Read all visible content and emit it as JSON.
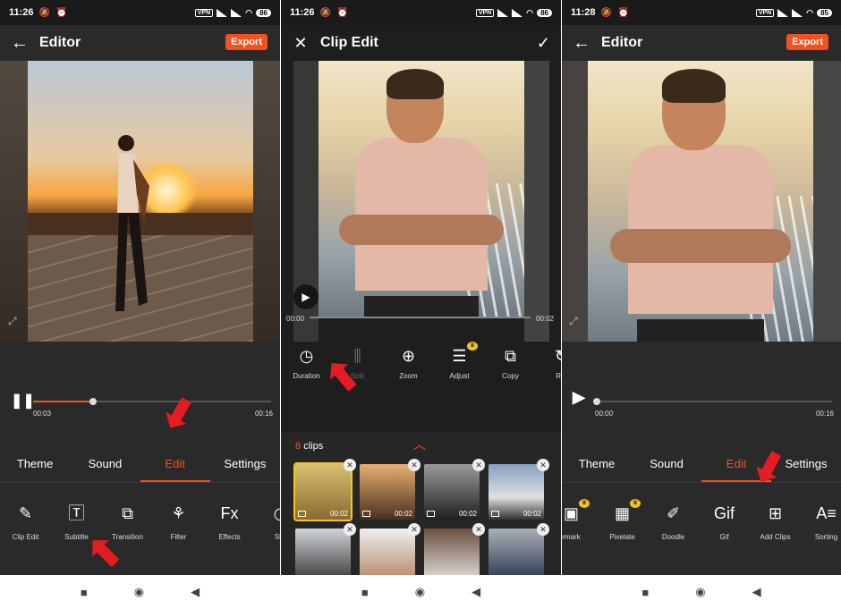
{
  "colors": {
    "accent": "#f4511e",
    "arrow": "#e51c23",
    "crown": "#f5c518"
  },
  "screen1": {
    "status": {
      "time": "11:26",
      "battery": "86",
      "vpn": "VPN"
    },
    "title": "Editor",
    "export_label": "Export",
    "time_current": "00:03",
    "time_total": "00:16",
    "progress_fraction": 0.25,
    "tabs": [
      "Theme",
      "Sound",
      "Edit",
      "Settings"
    ],
    "active_tab": "Edit",
    "tools": [
      {
        "icon": "clip-edit-icon",
        "label": "Clip Edit"
      },
      {
        "icon": "subtitle-icon",
        "label": "Subtitle"
      },
      {
        "icon": "transition-icon",
        "label": "Transition"
      },
      {
        "icon": "filter-icon",
        "label": "Filter"
      },
      {
        "icon": "effects-icon",
        "label": "Effects"
      },
      {
        "icon": "sticker-icon",
        "label": "Stic"
      }
    ]
  },
  "screen2": {
    "status": {
      "time": "11:26",
      "battery": "86",
      "vpn": "VPN"
    },
    "title": "Clip Edit",
    "time_start": "00:00",
    "time_end": "00:02",
    "tools": [
      {
        "icon": "duration-icon",
        "label": "Duration"
      },
      {
        "icon": "split-icon",
        "label": "Split"
      },
      {
        "icon": "zoom-icon",
        "label": "Zoom"
      },
      {
        "icon": "adjust-icon",
        "label": "Adjust"
      },
      {
        "icon": "copy-icon",
        "label": "Copy"
      },
      {
        "icon": "rotate-icon",
        "label": "Rot"
      }
    ],
    "clips_count": "8",
    "clips_word": "clips",
    "clips": [
      {
        "duration": "00:02",
        "selected": true
      },
      {
        "duration": "00:02",
        "selected": false
      },
      {
        "duration": "00:02",
        "selected": false
      },
      {
        "duration": "00:02",
        "selected": false
      },
      {
        "duration": "",
        "selected": false
      },
      {
        "duration": "",
        "selected": false
      },
      {
        "duration": "",
        "selected": false
      },
      {
        "duration": "",
        "selected": false
      }
    ]
  },
  "screen3": {
    "status": {
      "time": "11:28",
      "battery": "85",
      "vpn": "VPN"
    },
    "title": "Editor",
    "export_label": "Export",
    "time_current": "00:00",
    "time_total": "00:16",
    "tabs": [
      "Theme",
      "Sound",
      "Edit",
      "Settings"
    ],
    "active_tab": "Edit",
    "tools": [
      {
        "icon": "watermark-icon",
        "label": "rmark"
      },
      {
        "icon": "pixelate-icon",
        "label": "Pixelate"
      },
      {
        "icon": "doodle-icon",
        "label": "Doodle"
      },
      {
        "icon": "gif-icon",
        "label": "Gif"
      },
      {
        "icon": "add-clips-icon",
        "label": "Add Clips"
      },
      {
        "icon": "sorting-icon",
        "label": "Sorting"
      }
    ]
  }
}
